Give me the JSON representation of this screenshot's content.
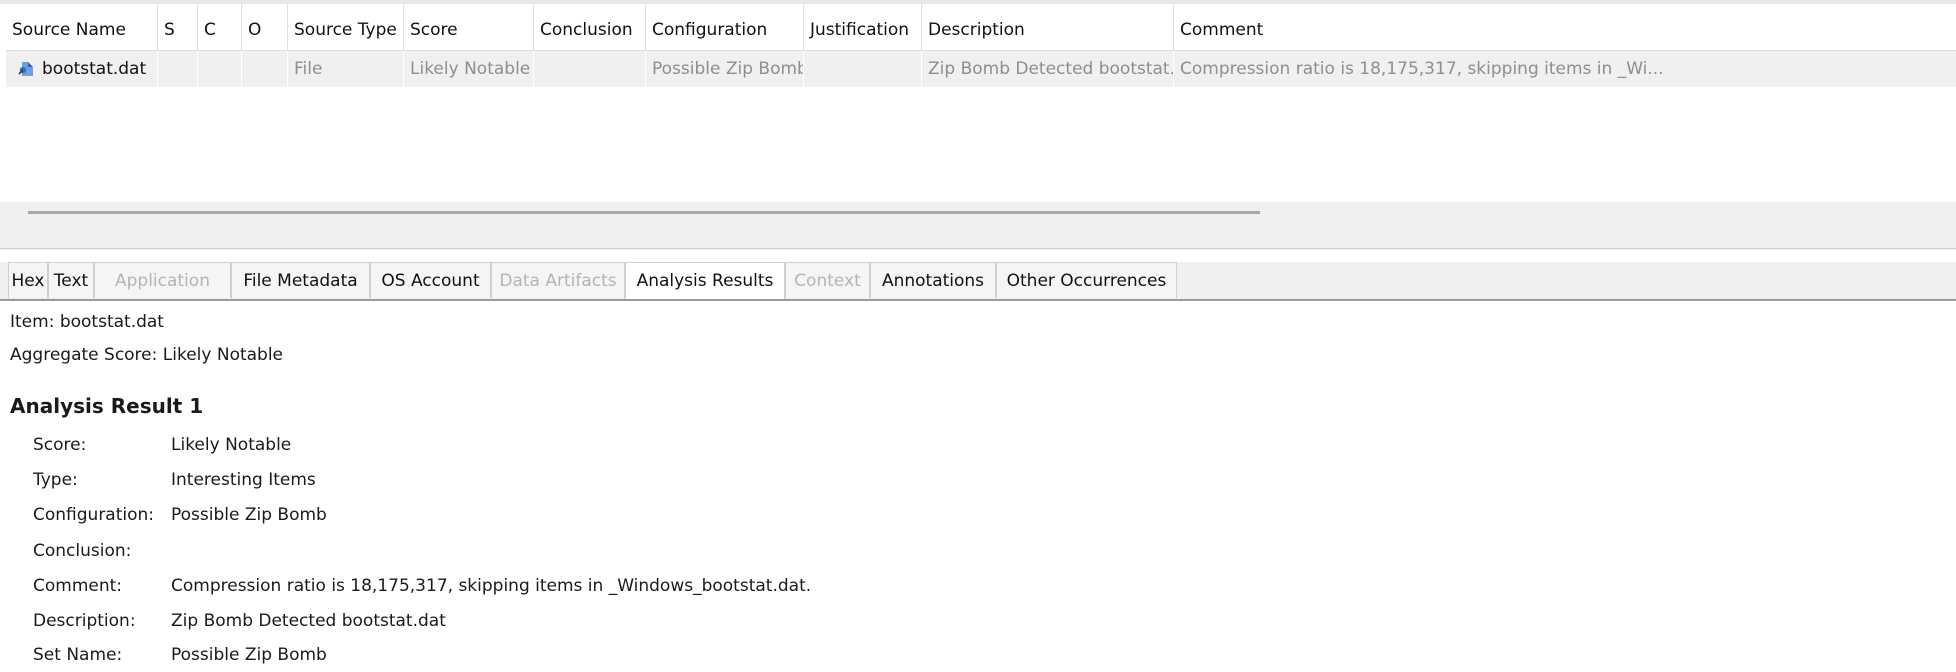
{
  "table": {
    "columns": [
      "Source Name",
      "S",
      "C",
      "O",
      "Source Type",
      "Score",
      "Conclusion",
      "Configuration",
      "Justification",
      "Description",
      "Comment"
    ],
    "rows": [
      {
        "source_name": "bootstat.dat",
        "s": "",
        "c": "",
        "o": "",
        "source_type": "File",
        "score": "Likely Notable",
        "conclusion": "",
        "configuration": "Possible Zip Bomb",
        "justification": "",
        "description": "Zip Bomb Detected bootstat.dat",
        "comment": "Compression ratio is 18,175,317, skipping items in _Wi..."
      }
    ]
  },
  "tabs": [
    {
      "label": "Hex",
      "enabled": true
    },
    {
      "label": "Text",
      "enabled": true
    },
    {
      "label": "Application",
      "enabled": false
    },
    {
      "label": "File Metadata",
      "enabled": true
    },
    {
      "label": "OS Account",
      "enabled": true
    },
    {
      "label": "Data Artifacts",
      "enabled": false
    },
    {
      "label": "Analysis Results",
      "enabled": true,
      "selected": true
    },
    {
      "label": "Context",
      "enabled": false
    },
    {
      "label": "Annotations",
      "enabled": true
    },
    {
      "label": "Other Occurrences",
      "enabled": true
    }
  ],
  "details": {
    "item_line": "Item: bootstat.dat",
    "aggregate_line": "Aggregate Score: Likely Notable",
    "result_heading": "Analysis Result 1",
    "fields": [
      {
        "label": "Score:",
        "value": "Likely Notable"
      },
      {
        "label": "Type:",
        "value": "Interesting Items"
      },
      {
        "label": "Configuration:",
        "value": "Possible Zip Bomb"
      },
      {
        "label": "Conclusion:",
        "value": ""
      },
      {
        "label": "Comment:",
        "value": "Compression ratio is 18,175,317, skipping items in _Windows_bootstat.dat."
      },
      {
        "label": "Description:",
        "value": "Zip Bomb Detected bootstat.dat"
      },
      {
        "label": "Set Name:",
        "value": "Possible Zip Bomb"
      }
    ]
  },
  "colors": {
    "disabled_text": "#b4b4b4",
    "row_background": "#f0f0f0",
    "cell_muted_text": "#8e8e8e"
  },
  "icons": {
    "file_row_icon": "interesting-file-icon"
  }
}
